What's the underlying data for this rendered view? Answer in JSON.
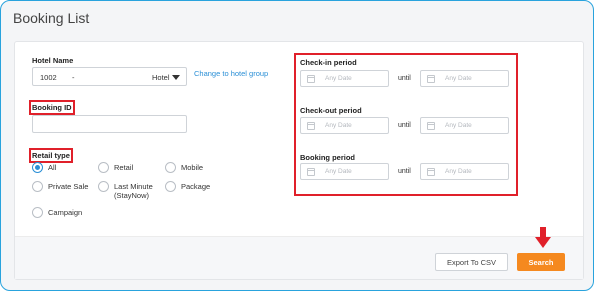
{
  "page": {
    "title": "Booking List"
  },
  "form": {
    "hotel_name": {
      "label": "Hotel Name",
      "value_code": "1002",
      "separator": "-",
      "value_type": "Hotel",
      "change_link": "Change to hotel group"
    },
    "booking_id": {
      "label": "Booking ID",
      "value": ""
    },
    "retail_type": {
      "label": "Retail type",
      "options": [
        "All",
        "Retail",
        "Mobile",
        "Private Sale",
        "Last Minute (StayNow)",
        "Package",
        "Campaign"
      ],
      "last_minute_line1": "Last Minute",
      "last_minute_line2": "(StayNow)",
      "selected": "All"
    },
    "checkin": {
      "label": "Check-in period",
      "from_placeholder": "Any Date",
      "until": "until",
      "to_placeholder": "Any Date"
    },
    "checkout": {
      "label": "Check-out period",
      "from_placeholder": "Any Date",
      "until": "until",
      "to_placeholder": "Any Date"
    },
    "booking_period": {
      "label": "Booking period",
      "from_placeholder": "Any Date",
      "until": "until",
      "to_placeholder": "Any Date"
    }
  },
  "actions": {
    "export_label": "Export To CSV",
    "search_label": "Search"
  },
  "colors": {
    "accent_blue": "#2a8fd6",
    "search_orange": "#f5891f",
    "highlight_red": "#e0202a",
    "frame_blue": "#29a3dd"
  }
}
